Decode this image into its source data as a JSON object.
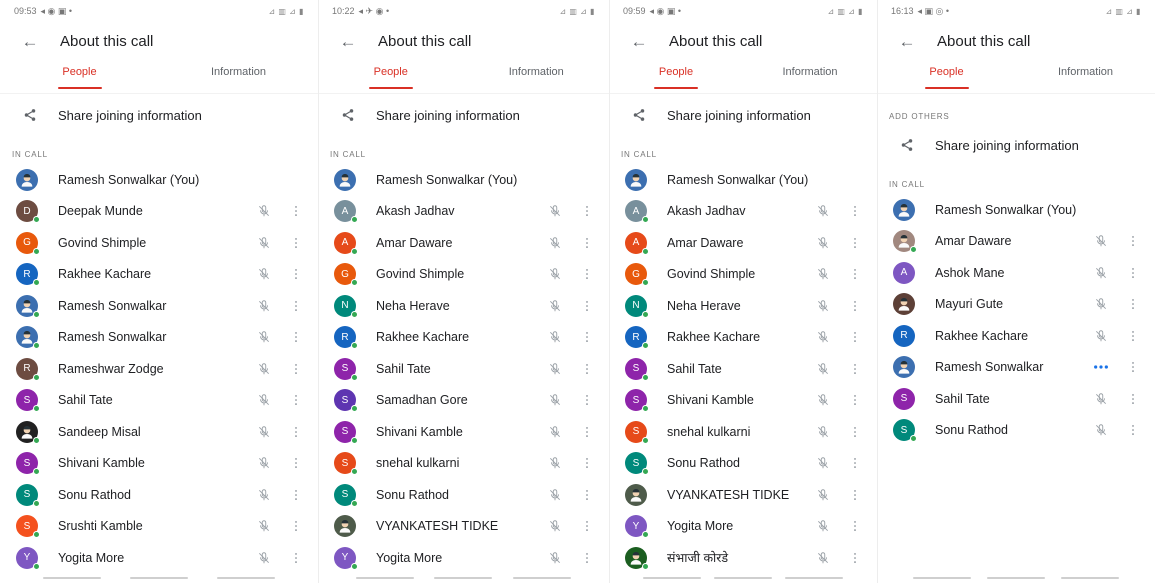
{
  "screens": [
    {
      "status": {
        "time": "09:53",
        "icons": "◂ ◉ ▣ •",
        "right": "⊿ ▥ ⊿ ▮"
      },
      "title": "About this call",
      "tabs": [
        {
          "label": "People",
          "active": true
        },
        {
          "label": "Information",
          "active": false
        }
      ],
      "add_others_label": "",
      "share_label": "Share joining information",
      "in_call_label": "IN CALL",
      "participants": [
        {
          "name": "Ramesh Sonwalkar (You)",
          "initial": "",
          "color": "#3c6fb0",
          "photo": true,
          "dot": false,
          "mic": false,
          "more": false
        },
        {
          "name": "Deepak Munde",
          "initial": "D",
          "color": "#6d4c41",
          "photo": false,
          "dot": true,
          "mic": true,
          "more": true
        },
        {
          "name": "Govind Shimple",
          "initial": "G",
          "color": "#e8590c",
          "photo": false,
          "dot": true,
          "mic": true,
          "more": true
        },
        {
          "name": "Rakhee Kachare",
          "initial": "R",
          "color": "#1565c0",
          "photo": false,
          "dot": true,
          "mic": true,
          "more": true
        },
        {
          "name": "Ramesh Sonwalkar",
          "initial": "",
          "color": "#3c6fb0",
          "photo": true,
          "dot": true,
          "mic": true,
          "more": true
        },
        {
          "name": "Ramesh Sonwalkar",
          "initial": "",
          "color": "#3c6fb0",
          "photo": true,
          "dot": true,
          "mic": true,
          "more": true
        },
        {
          "name": "Rameshwar Zodge",
          "initial": "R",
          "color": "#6d4c41",
          "photo": false,
          "dot": true,
          "mic": true,
          "more": true
        },
        {
          "name": "Sahil Tate",
          "initial": "S",
          "color": "#8e24aa",
          "photo": false,
          "dot": true,
          "mic": true,
          "more": true
        },
        {
          "name": "Sandeep Misal",
          "initial": "",
          "color": "#212121",
          "photo": true,
          "dot": true,
          "mic": true,
          "more": true
        },
        {
          "name": "Shivani Kamble",
          "initial": "S",
          "color": "#8e24aa",
          "photo": false,
          "dot": true,
          "mic": true,
          "more": true
        },
        {
          "name": "Sonu Rathod",
          "initial": "S",
          "color": "#00897b",
          "photo": false,
          "dot": true,
          "mic": true,
          "more": true
        },
        {
          "name": "Srushti Kamble",
          "initial": "S",
          "color": "#f4511e",
          "photo": false,
          "dot": true,
          "mic": true,
          "more": true
        },
        {
          "name": "Yogita More",
          "initial": "Y",
          "color": "#7e57c2",
          "photo": false,
          "dot": true,
          "mic": true,
          "more": true
        }
      ]
    },
    {
      "status": {
        "time": "10:22",
        "icons": "◂ ✈ ◉ •",
        "right": "⊿ ▥ ⊿ ▮"
      },
      "title": "About this call",
      "tabs": [
        {
          "label": "People",
          "active": true
        },
        {
          "label": "Information",
          "active": false
        }
      ],
      "add_others_label": "",
      "share_label": "Share joining information",
      "in_call_label": "IN CALL",
      "participants": [
        {
          "name": "Ramesh Sonwalkar (You)",
          "initial": "",
          "color": "#3c6fb0",
          "photo": true,
          "dot": false,
          "mic": false,
          "more": false
        },
        {
          "name": "Akash Jadhav",
          "initial": "A",
          "color": "#78909c",
          "photo": false,
          "dot": true,
          "mic": true,
          "more": true
        },
        {
          "name": "Amar Daware",
          "initial": "A",
          "color": "#e64a19",
          "photo": false,
          "dot": true,
          "mic": true,
          "more": true
        },
        {
          "name": "Govind Shimple",
          "initial": "G",
          "color": "#e8590c",
          "photo": false,
          "dot": true,
          "mic": true,
          "more": true
        },
        {
          "name": "Neha Herave",
          "initial": "N",
          "color": "#00897b",
          "photo": false,
          "dot": true,
          "mic": true,
          "more": true
        },
        {
          "name": "Rakhee Kachare",
          "initial": "R",
          "color": "#1565c0",
          "photo": false,
          "dot": true,
          "mic": true,
          "more": true
        },
        {
          "name": "Sahil Tate",
          "initial": "S",
          "color": "#8e24aa",
          "photo": false,
          "dot": true,
          "mic": true,
          "more": true
        },
        {
          "name": "Samadhan Gore",
          "initial": "S",
          "color": "#5e35b1",
          "photo": false,
          "dot": true,
          "mic": true,
          "more": true
        },
        {
          "name": "Shivani Kamble",
          "initial": "S",
          "color": "#8e24aa",
          "photo": false,
          "dot": true,
          "mic": true,
          "more": true
        },
        {
          "name": "snehal kulkarni",
          "initial": "S",
          "color": "#e64a19",
          "photo": false,
          "dot": true,
          "mic": true,
          "more": true
        },
        {
          "name": "Sonu Rathod",
          "initial": "S",
          "color": "#00897b",
          "photo": false,
          "dot": true,
          "mic": true,
          "more": true
        },
        {
          "name": "VYANKATESH TIDKE",
          "initial": "",
          "color": "#4e5b4a",
          "photo": true,
          "dot": false,
          "mic": true,
          "more": true
        },
        {
          "name": "Yogita More",
          "initial": "Y",
          "color": "#7e57c2",
          "photo": false,
          "dot": true,
          "mic": true,
          "more": true
        }
      ]
    },
    {
      "status": {
        "time": "09:59",
        "icons": "◂ ◉ ▣ •",
        "right": "⊿ ▥ ⊿ ▮"
      },
      "title": "About this call",
      "tabs": [
        {
          "label": "People",
          "active": true
        },
        {
          "label": "Information",
          "active": false
        }
      ],
      "add_others_label": "",
      "share_label": "Share joining information",
      "in_call_label": "IN CALL",
      "participants": [
        {
          "name": "Ramesh Sonwalkar (You)",
          "initial": "",
          "color": "#3c6fb0",
          "photo": true,
          "dot": false,
          "mic": false,
          "more": false
        },
        {
          "name": "Akash Jadhav",
          "initial": "A",
          "color": "#78909c",
          "photo": false,
          "dot": true,
          "mic": true,
          "more": true
        },
        {
          "name": "Amar Daware",
          "initial": "A",
          "color": "#e64a19",
          "photo": false,
          "dot": true,
          "mic": true,
          "more": true
        },
        {
          "name": "Govind Shimple",
          "initial": "G",
          "color": "#e8590c",
          "photo": false,
          "dot": true,
          "mic": true,
          "more": true
        },
        {
          "name": "Neha Herave",
          "initial": "N",
          "color": "#00897b",
          "photo": false,
          "dot": true,
          "mic": true,
          "more": true
        },
        {
          "name": "Rakhee Kachare",
          "initial": "R",
          "color": "#1565c0",
          "photo": false,
          "dot": true,
          "mic": true,
          "more": true
        },
        {
          "name": "Sahil Tate",
          "initial": "S",
          "color": "#8e24aa",
          "photo": false,
          "dot": true,
          "mic": true,
          "more": true
        },
        {
          "name": "Shivani Kamble",
          "initial": "S",
          "color": "#8e24aa",
          "photo": false,
          "dot": true,
          "mic": true,
          "more": true
        },
        {
          "name": "snehal kulkarni",
          "initial": "S",
          "color": "#e64a19",
          "photo": false,
          "dot": true,
          "mic": true,
          "more": true
        },
        {
          "name": "Sonu Rathod",
          "initial": "S",
          "color": "#00897b",
          "photo": false,
          "dot": true,
          "mic": true,
          "more": true
        },
        {
          "name": "VYANKATESH TIDKE",
          "initial": "",
          "color": "#4e5b4a",
          "photo": true,
          "dot": false,
          "mic": true,
          "more": true
        },
        {
          "name": "Yogita More",
          "initial": "Y",
          "color": "#7e57c2",
          "photo": false,
          "dot": true,
          "mic": true,
          "more": true
        },
        {
          "name": "संभाजी कोरडे",
          "initial": "",
          "color": "#1b5e20",
          "photo": true,
          "dot": true,
          "mic": true,
          "more": true
        }
      ]
    },
    {
      "status": {
        "time": "16:13",
        "icons": "◂ ▣ ◎ •",
        "right": "⊿ ▥ ⊿ ▮"
      },
      "title": "About this call",
      "tabs": [
        {
          "label": "People",
          "active": true
        },
        {
          "label": "Information",
          "active": false
        }
      ],
      "add_others_label": "ADD OTHERS",
      "share_label": "Share joining information",
      "in_call_label": "IN CALL",
      "participants": [
        {
          "name": "Ramesh Sonwalkar (You)",
          "initial": "",
          "color": "#3c6fb0",
          "photo": true,
          "dot": false,
          "mic": false,
          "more": false
        },
        {
          "name": "Amar Daware",
          "initial": "",
          "color": "#a1887f",
          "photo": true,
          "dot": true,
          "mic": true,
          "more": true
        },
        {
          "name": "Ashok Mane",
          "initial": "A",
          "color": "#7e57c2",
          "photo": false,
          "dot": false,
          "mic": true,
          "more": true
        },
        {
          "name": "Mayuri Gute",
          "initial": "",
          "color": "#5d4037",
          "photo": true,
          "dot": false,
          "mic": true,
          "more": true
        },
        {
          "name": "Rakhee Kachare",
          "initial": "R",
          "color": "#1565c0",
          "photo": false,
          "dot": false,
          "mic": true,
          "more": true
        },
        {
          "name": "Ramesh Sonwalkar",
          "initial": "",
          "color": "#3c6fb0",
          "photo": true,
          "dot": false,
          "mic": false,
          "more": true,
          "speaking": true
        },
        {
          "name": "Sahil Tate",
          "initial": "S",
          "color": "#8e24aa",
          "photo": false,
          "dot": false,
          "mic": true,
          "more": true
        },
        {
          "name": "Sonu Rathod",
          "initial": "S",
          "color": "#00897b",
          "photo": false,
          "dot": true,
          "mic": true,
          "more": true
        }
      ]
    }
  ],
  "colors": {
    "accent": "#d93025",
    "online": "#34a853",
    "speaking": "#1a73e8"
  }
}
